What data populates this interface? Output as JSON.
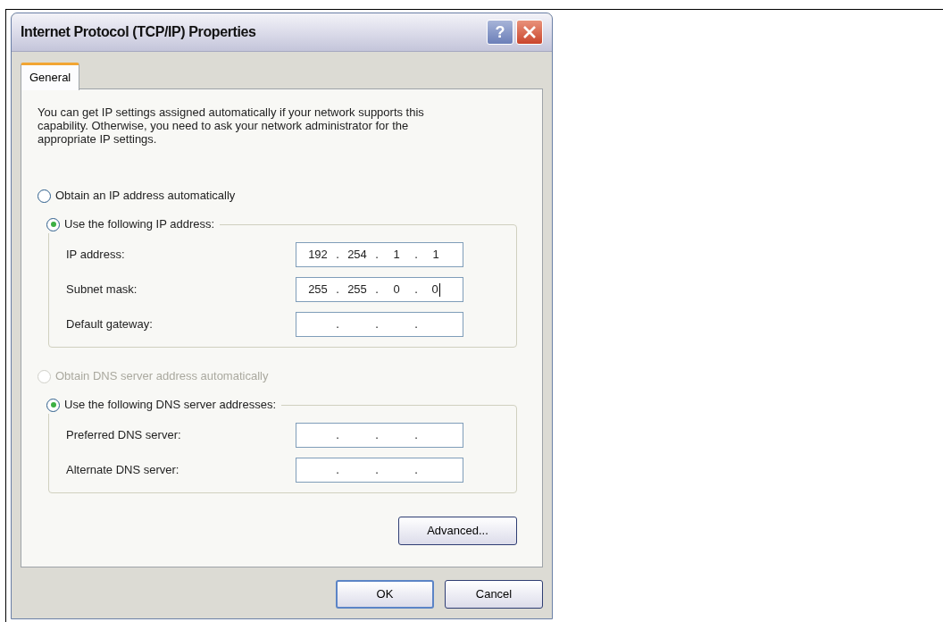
{
  "window": {
    "title": "Internet Protocol (TCP/IP) Properties",
    "title_buttons": [
      {
        "kind": "help",
        "label": "?"
      },
      {
        "kind": "close"
      }
    ]
  },
  "tabs": [
    {
      "label": "General",
      "selected": true
    }
  ],
  "description": "You can get IP settings assigned automatically if your network supports this capability. Otherwise, you need to ask your network administrator for the appropriate IP settings.",
  "ip_section": {
    "options": [
      {
        "label": "Obtain an IP address automatically",
        "selected": false,
        "disabled": false
      },
      {
        "label": "Use the following IP address:",
        "selected": true,
        "disabled": false
      }
    ],
    "fields": [
      {
        "label": "IP address:",
        "separator": ".",
        "octets": [
          "192",
          "254",
          "1",
          "1"
        ],
        "cursor": false
      },
      {
        "label": "Subnet mask:",
        "separator": ".",
        "octets": [
          "255",
          "255",
          "0",
          "0"
        ],
        "cursor": true
      },
      {
        "label": "Default gateway:",
        "separator": ".",
        "cursor": false
      }
    ]
  },
  "dns_section": {
    "options": [
      {
        "label": "Obtain DNS server address automatically",
        "selected": false,
        "disabled": true
      },
      {
        "label": "Use the following DNS server addresses:",
        "selected": true,
        "disabled": false
      }
    ],
    "fields": [
      {
        "label": "Preferred DNS server:",
        "separator": ".",
        "cursor": false
      },
      {
        "label": "Alternate DNS server:",
        "separator": ".",
        "cursor": false
      }
    ]
  },
  "advanced_button": "Advanced...",
  "buttons": [
    {
      "label": "OK",
      "default": true
    },
    {
      "label": "Cancel",
      "default": false
    }
  ]
}
